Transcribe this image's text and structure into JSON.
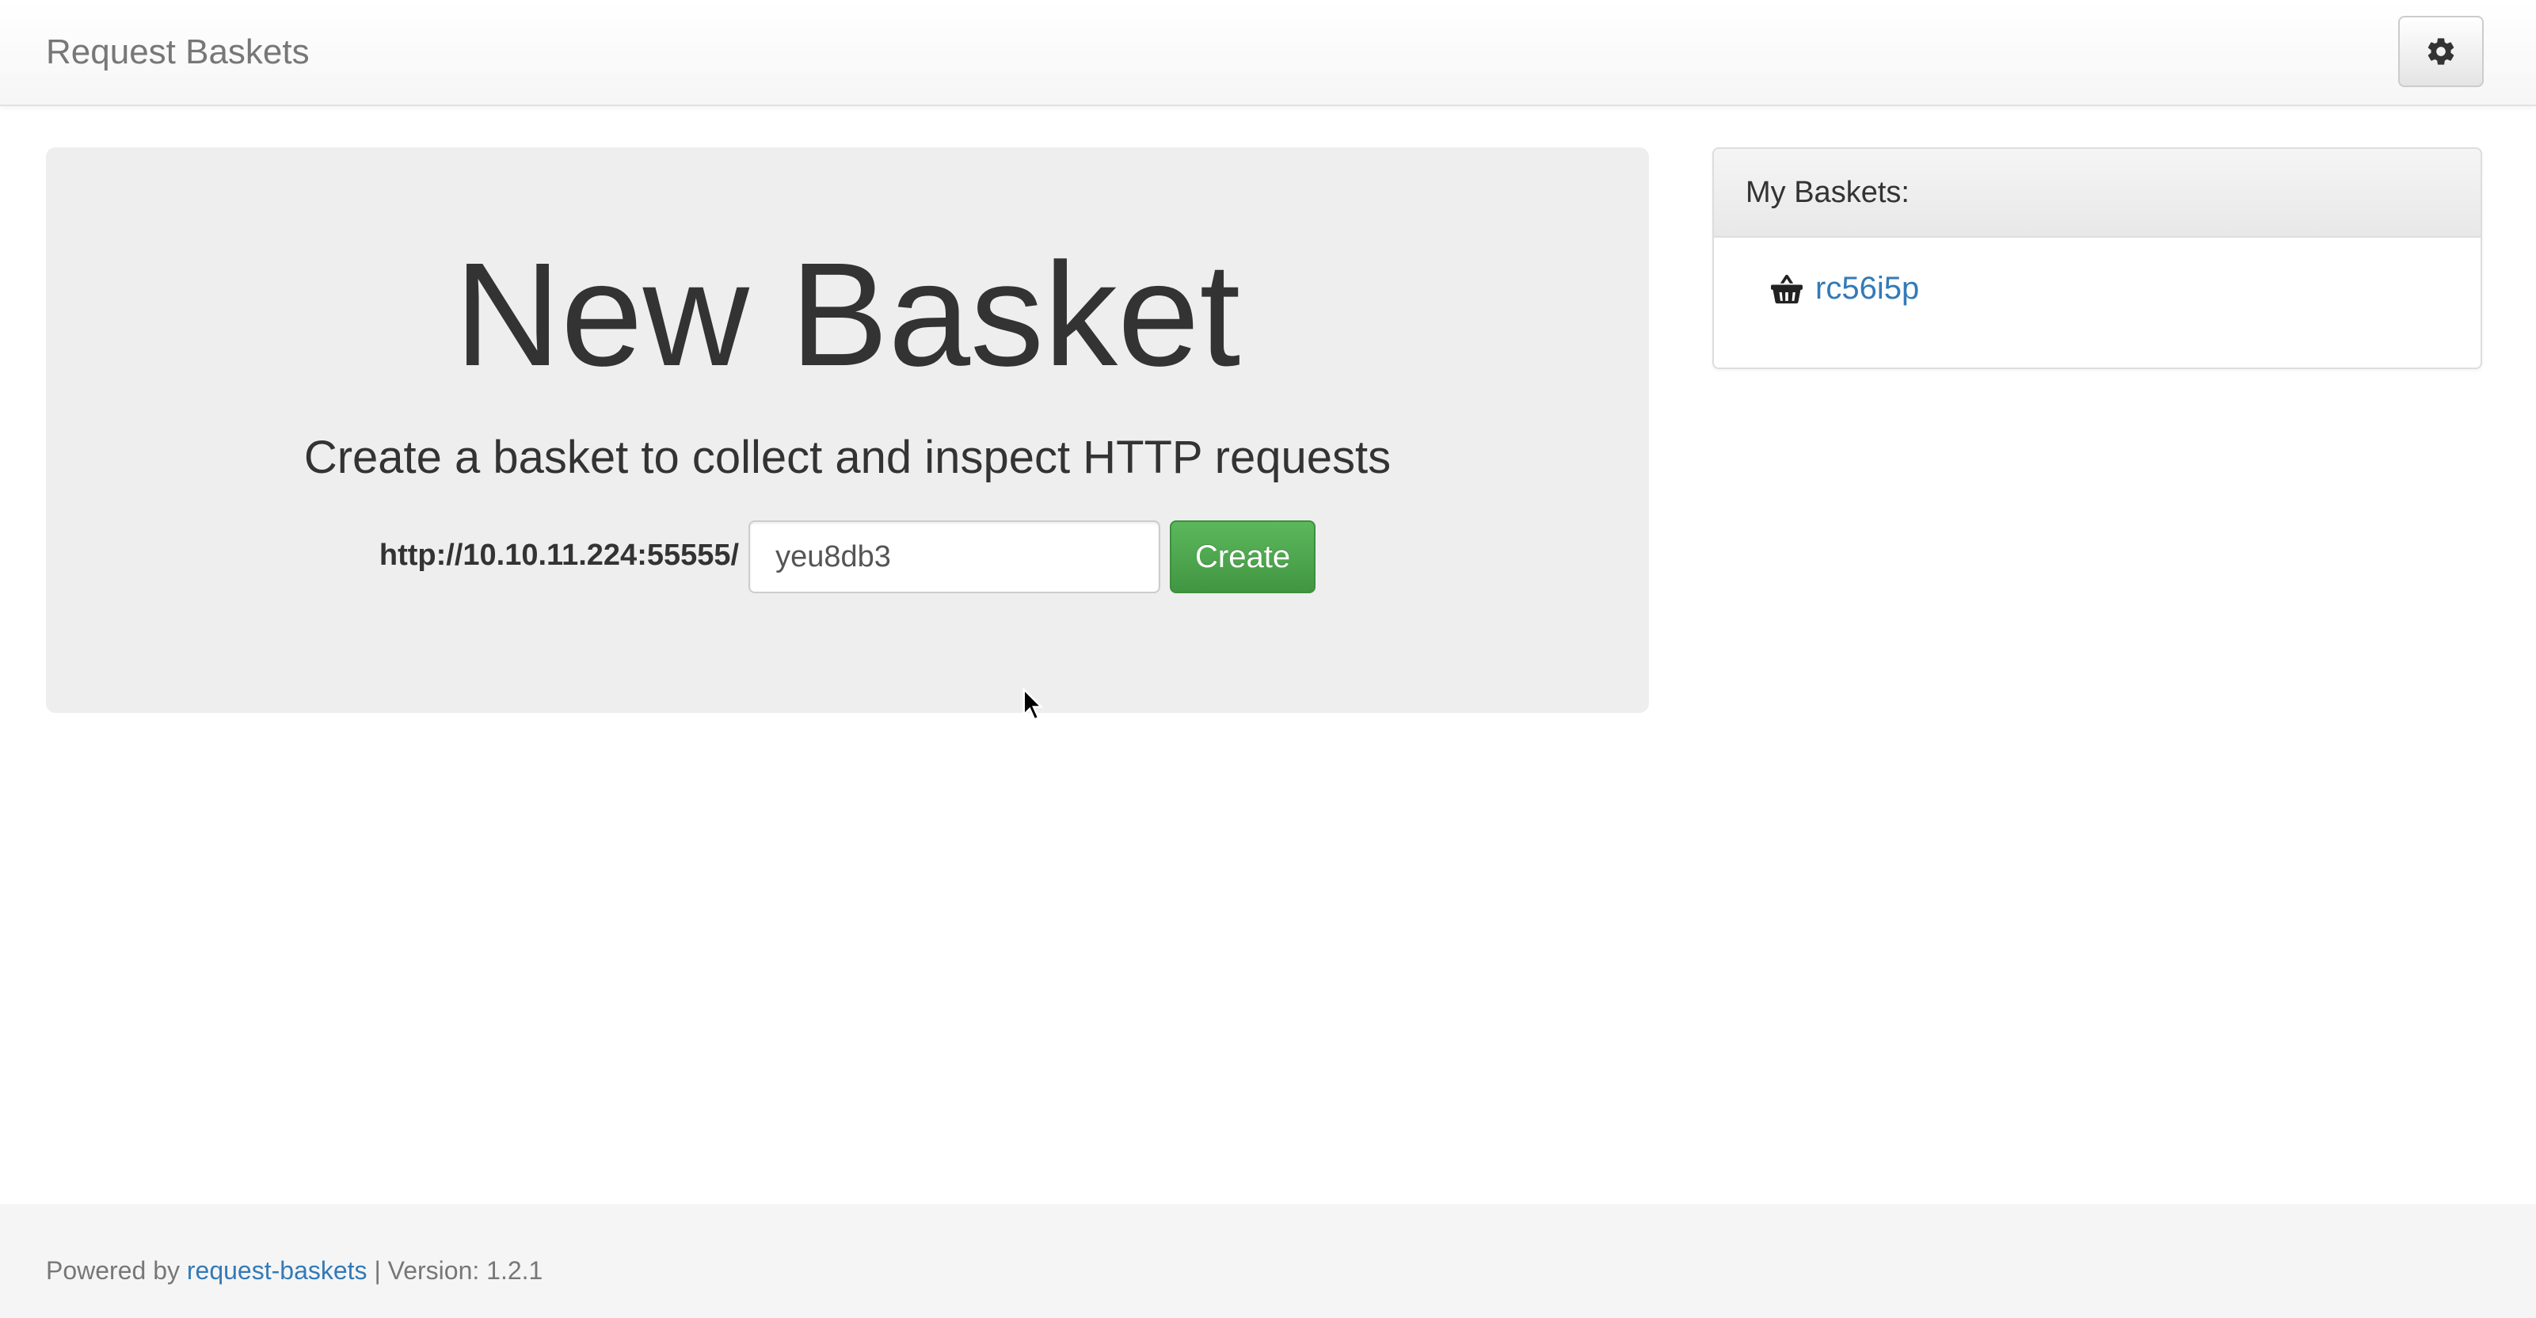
{
  "navbar": {
    "brand": "Request Baskets",
    "settings_icon": "gear-icon"
  },
  "jumbotron": {
    "title": "New Basket",
    "subtitle": "Create a basket to collect and inspect HTTP requests",
    "base_url": "http://10.10.11.224:55555/",
    "basket_name_value": "yeu8db3",
    "create_label": "Create"
  },
  "baskets_panel": {
    "heading": "My Baskets:",
    "items": [
      {
        "icon": "basket-icon",
        "name": "rc56i5p"
      }
    ]
  },
  "footer": {
    "powered_by": "Powered by",
    "project_link": "request-baskets",
    "separator": "|",
    "version_label": "Version: 1.2.1"
  },
  "colors": {
    "link": "#337ab7",
    "create_button": "#5cb85c",
    "jumbotron_bg": "#eeeeee",
    "footer_bg": "#f5f5f5"
  }
}
